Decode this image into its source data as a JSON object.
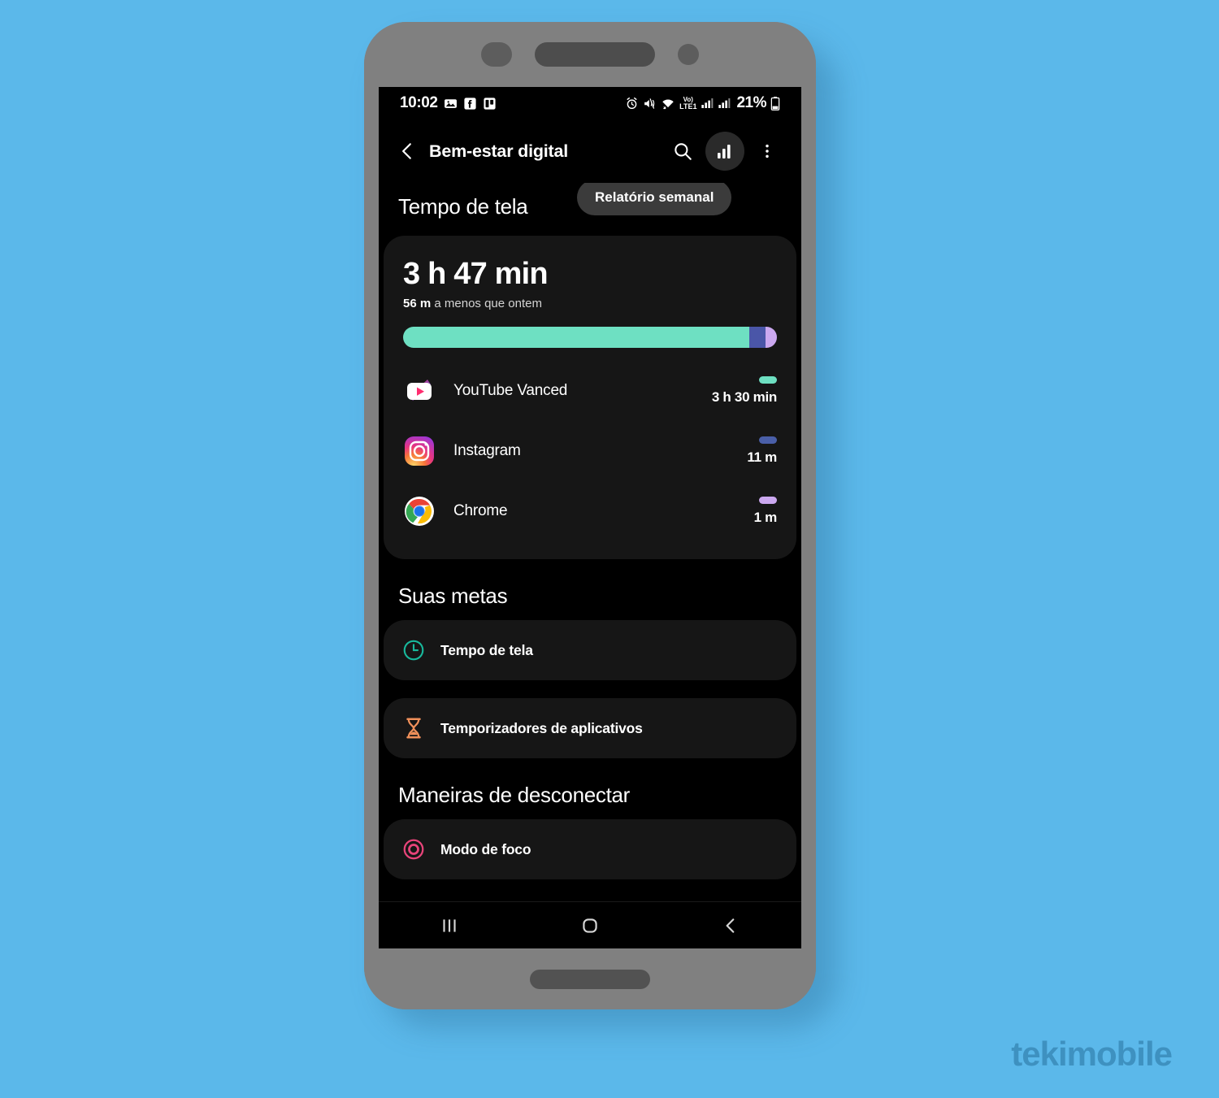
{
  "watermark": "tekimobile",
  "statusbar": {
    "time": "10:02",
    "left_icons": [
      "image-icon",
      "facebook-icon",
      "trello-icon"
    ],
    "right_icons": [
      "alarm-icon",
      "mute-icon",
      "wifi-icon",
      "volte-icon",
      "signal-1-icon",
      "signal-2-icon"
    ],
    "volte_label_top": "Vo)",
    "volte_label_bottom": "LTE1",
    "battery_percent": "21%"
  },
  "actionbar": {
    "back_icon": "back-chevron-icon",
    "title": "Bem-estar digital",
    "search_icon": "search-icon",
    "chart_icon": "bar-chart-icon",
    "overflow_icon": "more-vertical-icon"
  },
  "screen_time": {
    "section_title": "Tempo de tela",
    "weekly_report_label": "Relatório semanal",
    "total": "3 h 47 min",
    "compare_value": "56 m",
    "compare_text": "a menos que ontem"
  },
  "usage_bar": {
    "segments": [
      {
        "name": "YouTube Vanced",
        "percent": 92.5,
        "color": "#6ee0c2"
      },
      {
        "name": "Instagram",
        "percent": 4.5,
        "color": "#4a56a8"
      },
      {
        "name": "Chrome",
        "percent": 3.0,
        "color": "#cba8f0"
      }
    ]
  },
  "apps": [
    {
      "icon": "youtube-vanced-icon",
      "name": "YouTube Vanced",
      "time": "3 h 30 min",
      "color": "#6ee0c2"
    },
    {
      "icon": "instagram-icon",
      "name": "Instagram",
      "time": "11 m",
      "color": "#4a5fa8"
    },
    {
      "icon": "chrome-icon",
      "name": "Chrome",
      "time": "1 m",
      "color": "#cba8f0"
    }
  ],
  "goals": {
    "section_title": "Suas metas",
    "items": [
      {
        "icon": "clock-icon",
        "label": "Tempo de tela",
        "color": "#18b89c"
      },
      {
        "icon": "hourglass-icon",
        "label": "Temporizadores de aplicativos",
        "color": "#f0905a"
      }
    ]
  },
  "disconnect": {
    "section_title": "Maneiras de desconectar",
    "items": [
      {
        "icon": "target-icon",
        "label": "Modo de foco",
        "color": "#e8447a"
      }
    ]
  },
  "navbar": {
    "recents_icon": "recents-icon",
    "home_icon": "home-icon",
    "back_icon": "nav-back-icon"
  }
}
